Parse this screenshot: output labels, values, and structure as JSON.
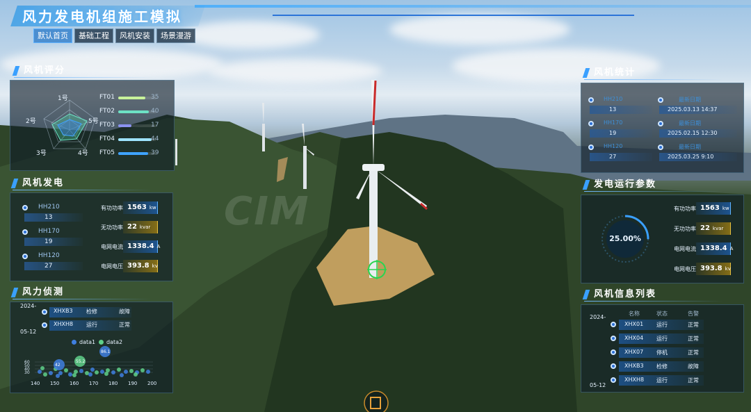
{
  "header": {
    "title": "风力发电机组施工模拟",
    "tabs": [
      "默认首页",
      "基础工程",
      "风机安装",
      "场景漫游"
    ],
    "active_tab": 0
  },
  "watermark": "CIM",
  "rating": {
    "title": "风机评分",
    "axes": [
      "1号",
      "5号",
      "4号",
      "3号",
      "2号"
    ],
    "items": [
      {
        "name": "FT01",
        "value": "35",
        "color": "#c9f29a"
      },
      {
        "name": "FT02",
        "value": "40",
        "color": "#6de2c5"
      },
      {
        "name": "FT03",
        "value": "17",
        "color": "#8a92f0"
      },
      {
        "name": "FT04",
        "value": "44",
        "color": "#9fe4ff"
      },
      {
        "name": "FT05",
        "value": "39",
        "color": "#3fa3ff"
      }
    ]
  },
  "generation": {
    "title": "风机发电",
    "units": [
      {
        "name": "HH210",
        "value": "13"
      },
      {
        "name": "HH170",
        "value": "19"
      },
      {
        "name": "HH120",
        "value": "27"
      }
    ],
    "metrics": [
      {
        "label": "有功功率",
        "value": "1563",
        "unit": "kw",
        "style": "blue"
      },
      {
        "label": "无功功率",
        "value": "22",
        "unit": "kvar",
        "style": "gold"
      },
      {
        "label": "电网电流",
        "value": "1338.4",
        "unit": "A",
        "style": "blue"
      },
      {
        "label": "电网电压",
        "value": "393.8",
        "unit": "kv",
        "style": "gold"
      }
    ]
  },
  "wind": {
    "title": "风力侦测",
    "date_labels": [
      "2024-",
      "05-12"
    ],
    "rows": [
      {
        "id": "XHXB3",
        "status": "检修",
        "state": "故障"
      },
      {
        "id": "XHXH8",
        "status": "运行",
        "state": "正常"
      }
    ],
    "legend": [
      "data1",
      "data2"
    ],
    "chart": {
      "y_ticks": [
        "60",
        "50",
        "40",
        "30"
      ],
      "x_ticks": [
        "140",
        "150",
        "160",
        "170",
        "180",
        "190",
        "200"
      ],
      "bubbles": [
        "42",
        "55.2",
        "86.1"
      ]
    }
  },
  "statistics": {
    "title": "风机统计",
    "rows": [
      {
        "name": "HH210",
        "value": "13",
        "date_label": "最新日期",
        "date": "2025.03.13  14:37"
      },
      {
        "name": "HH170",
        "value": "19",
        "date_label": "最新日期",
        "date": "2025.02.15  12:30"
      },
      {
        "name": "HH120",
        "value": "27",
        "date_label": "最新日期",
        "date": "2025.03.25  9:10"
      }
    ]
  },
  "params": {
    "title": "发电运行参数",
    "gauge_text": "25.00%",
    "gauge_value": 0.25,
    "metrics": [
      {
        "label": "有功功率",
        "value": "1563",
        "unit": "kw",
        "style": "blue"
      },
      {
        "label": "无功功率",
        "value": "22",
        "unit": "kvar",
        "style": "gold"
      },
      {
        "label": "电网电流",
        "value": "1338.4",
        "unit": "A",
        "style": "blue"
      },
      {
        "label": "电网电压",
        "value": "393.8",
        "unit": "kv",
        "style": "gold"
      }
    ]
  },
  "info_list": {
    "title": "风机信息列表",
    "headers": [
      "名称",
      "状态",
      "告警"
    ],
    "date_labels": [
      "2024-",
      "05-12"
    ],
    "rows": [
      {
        "name": "XHX01",
        "status": "运行",
        "alarm": "正常"
      },
      {
        "name": "XHX04",
        "status": "运行",
        "alarm": "正常"
      },
      {
        "name": "XHX07",
        "status": "停机",
        "alarm": "正常"
      },
      {
        "name": "XHXB3",
        "status": "检修",
        "alarm": "故障"
      },
      {
        "name": "XHXH8",
        "status": "运行",
        "alarm": "正常"
      }
    ]
  },
  "colors": {
    "accent": "#3aa0ff",
    "gold": "#e6c040",
    "panel": "#0e1c26"
  }
}
